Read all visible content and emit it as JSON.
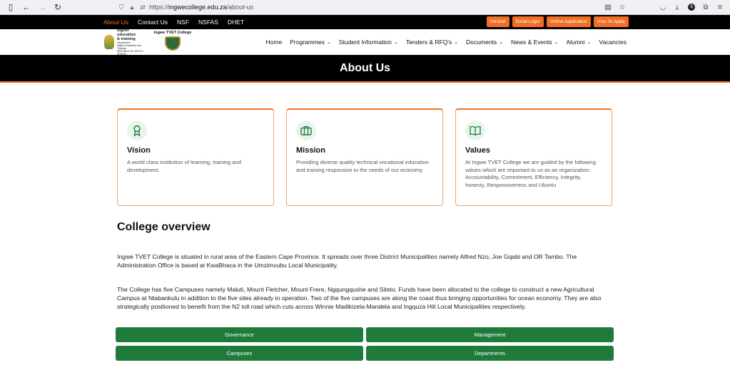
{
  "browser": {
    "url_prefix": "https://",
    "url_host": "ingwecollege.edu.za",
    "url_path": "/about-us"
  },
  "topbar": {
    "links": [
      "About Us",
      "Contact Us",
      "NSF",
      "NSFAS",
      "DHET"
    ],
    "buttons": [
      "Intranet",
      "Email Login",
      "Online Application",
      "How To Apply"
    ]
  },
  "header": {
    "logo1_lines": [
      "higher education",
      "& training",
      "Department:",
      "Higher Education and Training",
      "REPUBLIC OF SOUTH AFRICA"
    ],
    "logo2_title": "Ingwe TVET College",
    "nav": [
      {
        "label": "Home",
        "dropdown": false
      },
      {
        "label": "Programmes",
        "dropdown": true
      },
      {
        "label": "Student Information",
        "dropdown": true
      },
      {
        "label": "Tenders & RFQ's",
        "dropdown": true
      },
      {
        "label": "Documents",
        "dropdown": true
      },
      {
        "label": "News & Events",
        "dropdown": true
      },
      {
        "label": "Alumni",
        "dropdown": true
      },
      {
        "label": "Vacancies",
        "dropdown": false
      }
    ]
  },
  "banner": {
    "title": "About Us"
  },
  "cards": [
    {
      "icon": "award-icon",
      "title": "Vision",
      "text": "A world class institution of learning, training and development."
    },
    {
      "icon": "briefcase-icon",
      "title": "Mission",
      "text": "Providing diverse quality technical vocational education and training responsive to the needs of our economy."
    },
    {
      "icon": "book-icon",
      "title": "Values",
      "text": "At Ingwe TVET College we are guided by the following values which are important to us as an organization: Accountability, Commitment, Efficiency, Integrity, honesty, Responsiveness and Ubuntu"
    }
  ],
  "overview": {
    "title": "College overview",
    "paragraphs": [
      "Ingwe TVET College is situated in rural area of the Eastern Cape Province. It spreads over three District Municipalities namely Alfred Nzo, Joe Gqabi and OR Tambo. The Administration Office is based at KwaBhaca in the Umzimvubu Local Municipality.",
      "The College has five Campuses namely Maluti, Mount Fletcher, Mount Frere, Ngqungqushe and Siteto. Funds have been allocated to the college to construct a new Agricultural Campus at Ntabankulu in addition to the five sites already in operation. Two of the five campuses are along the coast thus bringing opportunities for ocean economy. They are also strategically positioned to benefit from the N2 toll road which cuts across Winnie Madikizela-Mandela and Ingquza Hill Local Municipalities respectively."
    ]
  },
  "buttons": [
    "Governance",
    "Management",
    "Campuses",
    "Departments"
  ],
  "colors": {
    "accent": "#f26e22",
    "green": "#1e7b3a",
    "black": "#000000"
  }
}
